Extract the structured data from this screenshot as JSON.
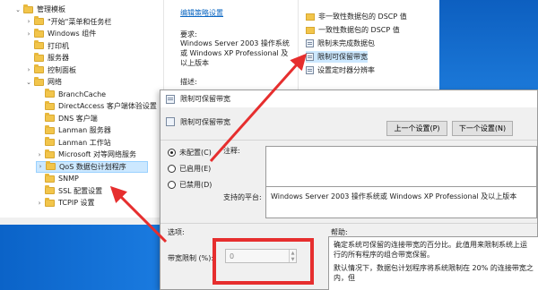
{
  "tree": {
    "items": [
      {
        "label": "管理模板",
        "chevron": "down"
      },
      {
        "label": "\"开始\"菜单和任务栏",
        "chevron": "right"
      },
      {
        "label": "Windows 组件",
        "chevron": "right"
      },
      {
        "label": "打印机",
        "chevron": ""
      },
      {
        "label": "服务器",
        "chevron": ""
      },
      {
        "label": "控制面板",
        "chevron": "right"
      },
      {
        "label": "网络",
        "chevron": "down"
      },
      {
        "label": "BranchCache",
        "chevron": ""
      },
      {
        "label": "DirectAccess 客户端体验设置",
        "chevron": ""
      },
      {
        "label": "DNS 客户端",
        "chevron": ""
      },
      {
        "label": "Lanman 服务器",
        "chevron": ""
      },
      {
        "label": "Lanman 工作站",
        "chevron": ""
      },
      {
        "label": "Microsoft 对等网络服务",
        "chevron": "right"
      },
      {
        "label": "QoS 数据包计划程序",
        "chevron": "right",
        "selected": true
      },
      {
        "label": "SNMP",
        "chevron": ""
      },
      {
        "label": "SSL 配置设置",
        "chevron": ""
      },
      {
        "label": "TCPIP 设置",
        "chevron": "right"
      }
    ]
  },
  "description": {
    "link": "编辑策略设置",
    "requirements_label": "要求:",
    "requirements": "Windows Server 2003 操作系统或 Windows XP Professional 及以上版本",
    "desc_label": "描述:"
  },
  "policy_list": {
    "items": [
      {
        "label": "非一致性数据包的 DSCP 值",
        "type": "folder"
      },
      {
        "label": "一致性数据包的 DSCP 值",
        "type": "folder"
      },
      {
        "label": "限制未完成数据包",
        "type": "policy"
      },
      {
        "label": "限制可保留带宽",
        "type": "policy",
        "selected": true
      },
      {
        "label": "设置定时器分辨率",
        "type": "policy"
      }
    ]
  },
  "dialog": {
    "title": "限制可保留带宽",
    "header": "限制可保留带宽",
    "prev_button": "上一个设置(P)",
    "next_button": "下一个设置(N)",
    "radios": [
      {
        "label": "未配置(C)",
        "checked": true
      },
      {
        "label": "已启用(E)",
        "checked": false
      },
      {
        "label": "已禁用(D)",
        "checked": false
      }
    ],
    "comment_label": "注释:",
    "supported_label": "支持的平台:",
    "supported_value": "Windows Server 2003 操作系统或 Windows XP Professional 及以上版本",
    "options_label": "选项:",
    "help_label": "帮助:",
    "bandwidth_label": "带宽限制 (%):",
    "bandwidth_value": "0",
    "help_text_1": "确定系统可保留的连接带宽的百分比。此值用来限制系统上运行的所有程序的组合带宽保留。",
    "help_text_2": "默认情况下，数据包计划程序将系统限制在 20% 的连接带宽之内，但"
  },
  "colors": {
    "highlight": "#e62e2e",
    "selection": "#cce8ff",
    "desktop": "#0d5fc0"
  }
}
